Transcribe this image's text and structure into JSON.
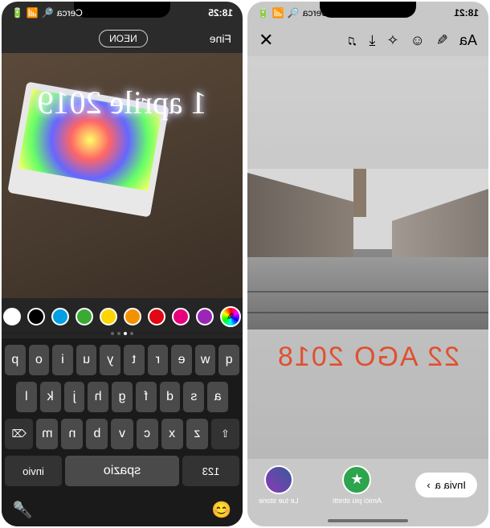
{
  "left": {
    "status": {
      "time": "18:25",
      "search_label": "Cerca"
    },
    "top_bar": {
      "done": "Fine",
      "font_style": "NEON"
    },
    "text_overlay": "1 aprile 2019",
    "color_palette": [
      "#9b26b6",
      "#e6007e",
      "#e30613",
      "#f39200",
      "#ffd500",
      "#3aaa35",
      "#009fe3",
      "#000000",
      "#ffffff"
    ],
    "keyboard": {
      "row1": [
        "q",
        "w",
        "e",
        "r",
        "t",
        "y",
        "u",
        "i",
        "o",
        "p"
      ],
      "row2": [
        "a",
        "s",
        "d",
        "f",
        "g",
        "h",
        "j",
        "k",
        "l"
      ],
      "row3_shift": "⇧",
      "row3": [
        "z",
        "x",
        "c",
        "v",
        "b",
        "n",
        "m"
      ],
      "row3_del": "⌫",
      "bottom": {
        "numbers": "123",
        "space": "spazio",
        "return": "invio"
      }
    }
  },
  "right": {
    "status": {
      "time": "18:21",
      "search_label": "Cerca"
    },
    "top_tools": {
      "text": "Aa",
      "draw": "✎",
      "sticker": "☺",
      "effects": "✧",
      "save": "⤓",
      "music": "♫",
      "close": "✕"
    },
    "date_stamp": "22 AGO 2018",
    "bottom": {
      "send_to": "Invia a",
      "send_arrow": "›",
      "close_friends_label": "Amici più stretti",
      "close_friends_icon": "★",
      "your_story_label": "Le tue storie"
    }
  }
}
